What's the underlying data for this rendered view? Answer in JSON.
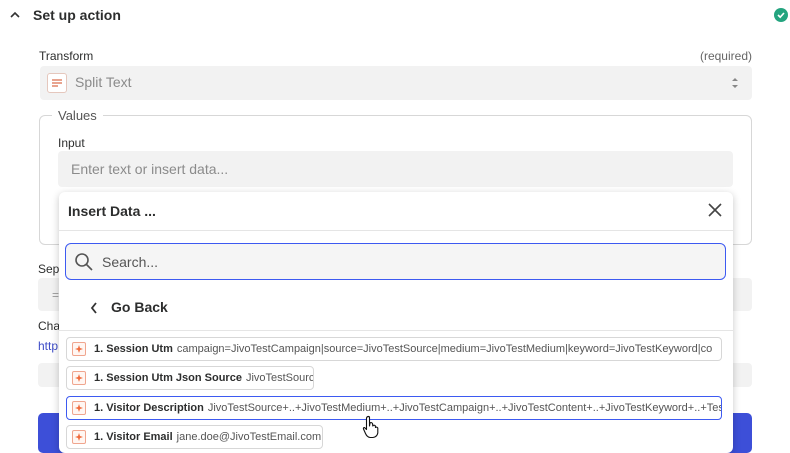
{
  "header": {
    "title": "Set up action"
  },
  "transform": {
    "label": "Transform",
    "required": "(required)",
    "value": "Split Text"
  },
  "values": {
    "legend": "Values",
    "input_label": "Input",
    "input_placeholder": "Enter text or insert data..."
  },
  "background": {
    "sep_label": "Sep",
    "sep_value": "=",
    "cha_label": "Cha",
    "link_text": "http"
  },
  "insert_data": {
    "title": "Insert Data ...",
    "search_placeholder": "Search...",
    "go_back": "Go Back",
    "items": [
      {
        "name": "1. Session Utm",
        "value": "campaign=JivoTestCampaign|source=JivoTestSource|medium=JivoTestMedium|keyword=JivoTestKeyword|co"
      },
      {
        "name": "1. Session Utm Json Source",
        "value": "JivoTestSource"
      },
      {
        "name": "1. Visitor Description",
        "value": "JivoTestSource+..+JivoTestMedium+..+JivoTestCampaign+..+JivoTestContent+..+JivoTestKeyword+..+TestC"
      },
      {
        "name": "1. Visitor Email",
        "value": "jane.doe@JivoTestEmail.com"
      }
    ]
  },
  "colors": {
    "accent": "#3d5af1",
    "success": "#24a47f",
    "button": "#3d4fd8",
    "app_icon": "#e8a48f"
  }
}
